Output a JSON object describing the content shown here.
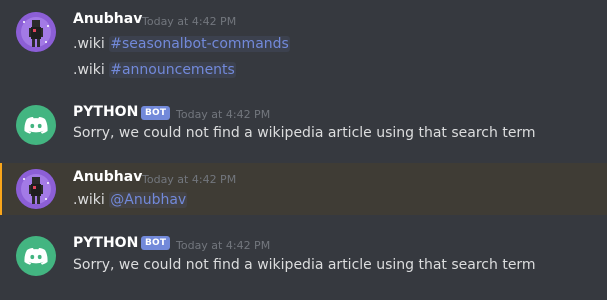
{
  "messages": [
    {
      "author": "Anubhav",
      "timestamp": "Today at 4:42 PM",
      "lines": [
        {
          "prefix": ".wiki ",
          "mention": "#seasonalbot-commands"
        },
        {
          "prefix": ".wiki ",
          "mention": "#announcements"
        }
      ]
    },
    {
      "author": "PYTHON",
      "badge": "BOT",
      "timestamp": "Today at 4:42 PM",
      "text": "Sorry, we could not find a wikipedia article using that search term"
    },
    {
      "author": "Anubhav",
      "timestamp": "Today at 4:42 PM",
      "lines": [
        {
          "prefix": ".wiki ",
          "mention": "@Anubhav"
        }
      ]
    },
    {
      "author": "PYTHON",
      "badge": "BOT",
      "timestamp": "Today at 4:42 PM",
      "text": "Sorry, we could not find a wikipedia article using that search term"
    }
  ],
  "colors": {
    "background": "#36393f",
    "highlight": "#3f3c35",
    "highlight_bar": "#faa61a",
    "mention": "#7289da",
    "bot_avatar": "#43b581",
    "bot_badge": "#7289da"
  },
  "icons": {
    "bot_avatar": "discord-logo-icon",
    "user_avatar": "user-avatar-image"
  }
}
